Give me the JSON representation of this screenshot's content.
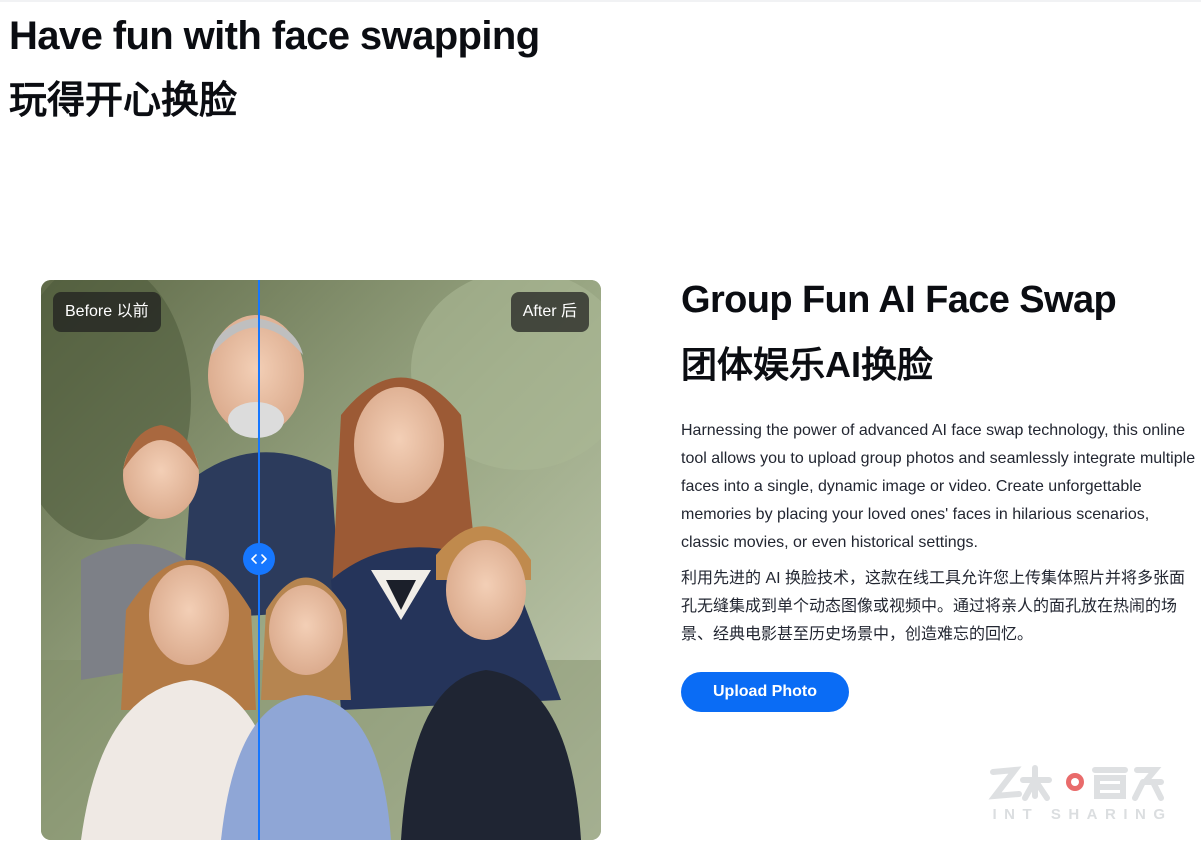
{
  "hero": {
    "title": "Have fun with face swapping",
    "title_cn": "玩得开心换脸"
  },
  "compare": {
    "before_label": "Before 以前",
    "after_label": "After 后",
    "handle_icon": "chevron-left-right-icon",
    "accent_color": "#1677ff"
  },
  "feature": {
    "title": "Group Fun AI Face Swap",
    "title_cn": "团体娱乐AI换脸",
    "description": "Harnessing the power of advanced AI face swap technology, this online tool allows you to upload group photos and seamlessly integrate multiple faces into a single, dynamic image or video. Create unforgettable memories by placing your loved ones' faces in hilarious scenarios, classic movies, or even historical settings.",
    "description_cn": "利用先进的 AI 换脸技术，这款在线工具允许您上传集体照片并将多张面孔无缝集成到单个动态图像或视频中。通过将亲人的面孔放在热闹的场景、经典电影甚至历史场景中，创造难忘的回忆。",
    "button_label": "Upload Photo",
    "button_color": "#0a6cf5"
  },
  "watermark": {
    "text": "INT SHARING"
  }
}
